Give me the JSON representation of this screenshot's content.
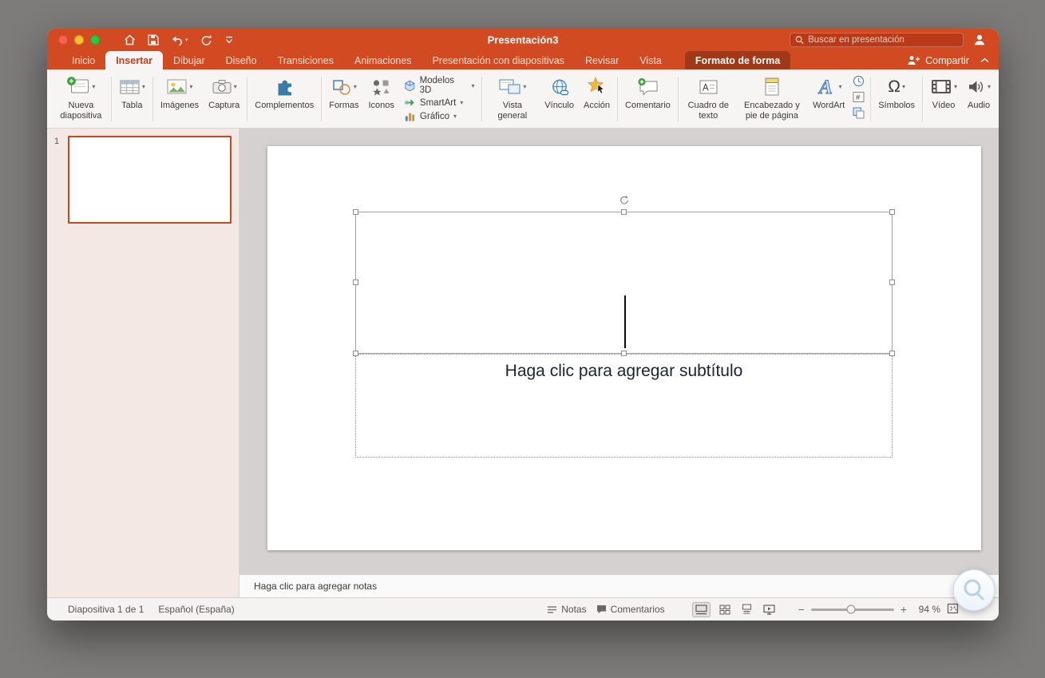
{
  "window": {
    "title": "Presentación3",
    "search_placeholder": "Buscar en presentación",
    "share_label": "Compartir"
  },
  "tabs": [
    {
      "label": "Inicio"
    },
    {
      "label": "Insertar"
    },
    {
      "label": "Dibujar"
    },
    {
      "label": "Diseño"
    },
    {
      "label": "Transiciones"
    },
    {
      "label": "Animaciones"
    },
    {
      "label": "Presentación con diapositivas"
    },
    {
      "label": "Revisar"
    },
    {
      "label": "Vista"
    }
  ],
  "contextual_tab": {
    "label": "Formato de forma"
  },
  "ribbon": {
    "nueva_diapositiva": "Nueva diapositiva",
    "tabla": "Tabla",
    "imagenes": "Imágenes",
    "captura": "Captura",
    "complementos": "Complementos",
    "formas": "Formas",
    "iconos": "Iconos",
    "modelos_3d": "Modelos 3D",
    "smartart": "SmartArt",
    "grafico": "Gráfico",
    "vista_general": "Vista general",
    "vinculo": "Vínculo",
    "accion": "Acción",
    "comentario": "Comentario",
    "cuadro_de_texto": "Cuadro de texto",
    "encabezado": "Encabezado y pie de página",
    "wordart": "WordArt",
    "simbolos": "Símbolos",
    "video": "Vídeo",
    "audio": "Audio",
    "omega": "Ω"
  },
  "slide_panel": {
    "slide_number": "1"
  },
  "slide": {
    "subtitle_placeholder": "Haga clic para agregar subtítulo"
  },
  "notes": {
    "placeholder": "Haga clic para agregar notas"
  },
  "statusbar": {
    "slide_info": "Diapositiva 1 de 1",
    "language": "Español (España)",
    "notes_label": "Notas",
    "comments_label": "Comentarios",
    "zoom_out": "−",
    "zoom_in": "+",
    "zoom_level": "94 %"
  },
  "colors": {
    "accent": "#d24a22",
    "contextual_tab_bg": "#a03917",
    "selected_thumb_border": "#c7471f"
  }
}
